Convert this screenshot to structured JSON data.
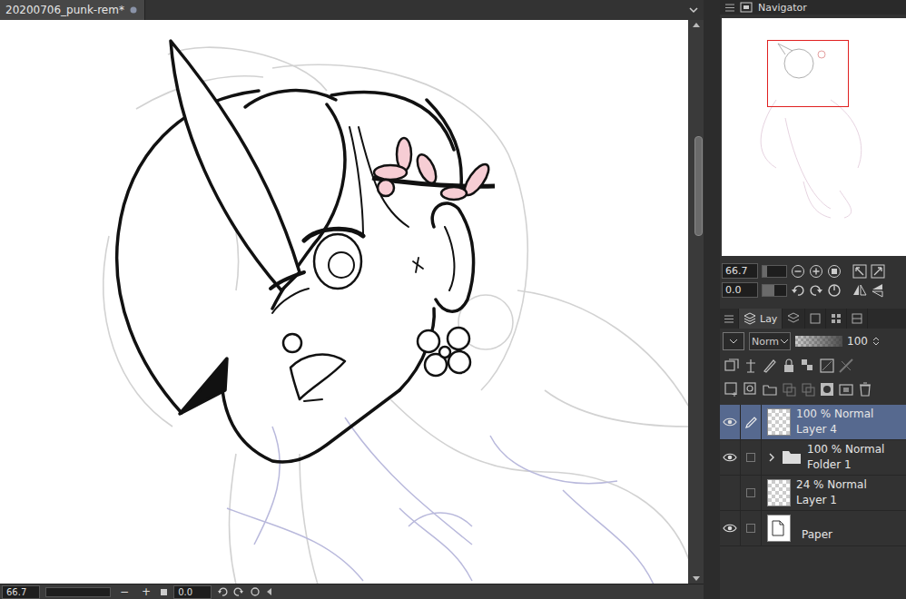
{
  "document_tab": {
    "title": "20200706_punk-rem*"
  },
  "navigator": {
    "title": "Navigator",
    "zoom": "66.7",
    "rotation": "0.0",
    "zoom_level": 0.2,
    "rotation_level": 0.5
  },
  "layer_panel": {
    "tab": "Lay",
    "blend_mode": "Norm",
    "opacity": "100",
    "opacity_level": 1.0
  },
  "layers": [
    {
      "kind": "raster",
      "mode": "100 % Normal",
      "name": "Layer 4",
      "visible": true,
      "editing": true,
      "selected": true,
      "expanded": false
    },
    {
      "kind": "folder",
      "mode": "100 % Normal",
      "name": "Folder 1",
      "visible": true,
      "editing": false,
      "selected": false,
      "expanded": false
    },
    {
      "kind": "raster",
      "mode": "24 % Normal",
      "name": "Layer 1",
      "visible": false,
      "editing": false,
      "selected": false,
      "expanded": false
    },
    {
      "kind": "paper",
      "mode": "",
      "name": "Paper",
      "visible": true,
      "editing": false,
      "selected": false,
      "expanded": false
    }
  ],
  "status_bar": {
    "zoom": "66.7",
    "zoom_out": "−",
    "zoom_in": "+",
    "rotation": "0.0"
  }
}
